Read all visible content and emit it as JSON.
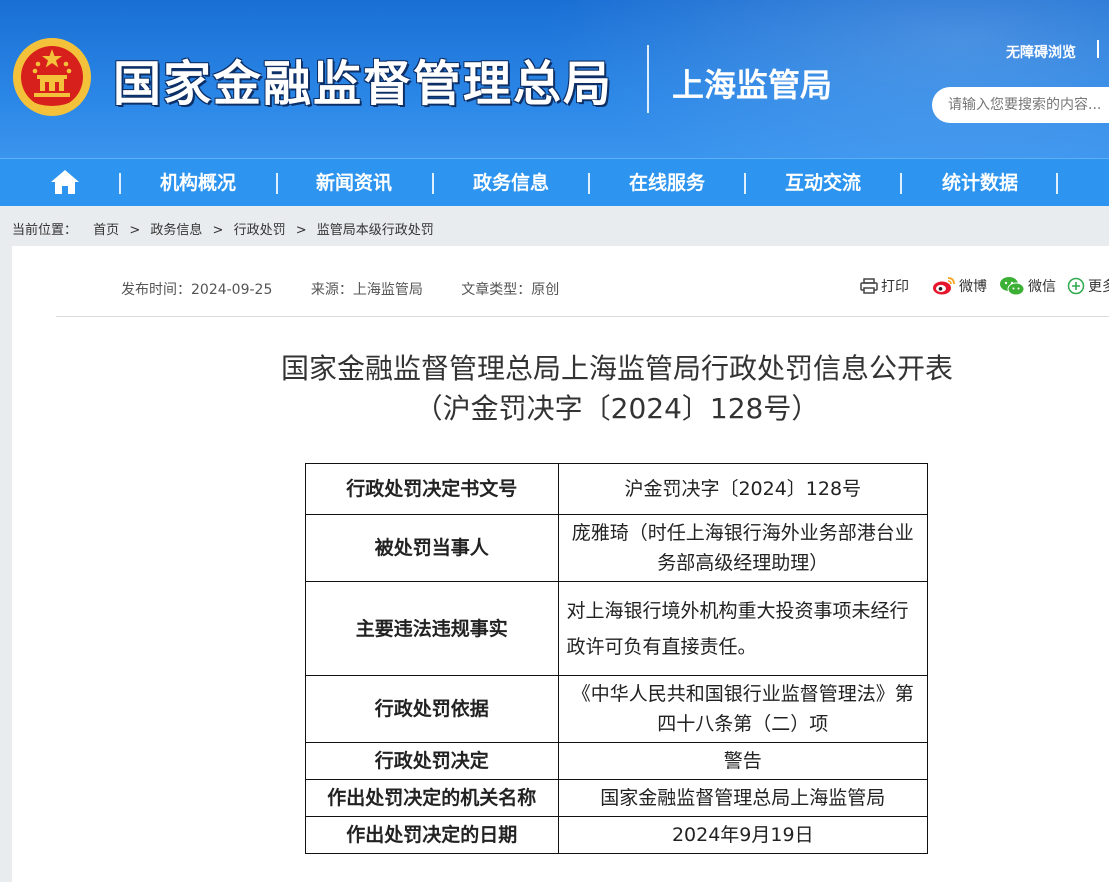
{
  "header": {
    "site_name": "国家金融监督管理总局",
    "sub_name": "上海监管局",
    "accessibility_link": "无障碍浏览",
    "search_placeholder": "请输入您要搜索的内容..."
  },
  "nav": {
    "items": [
      "机构概况",
      "新闻资讯",
      "政务信息",
      "在线服务",
      "互动交流",
      "统计数据"
    ]
  },
  "breadcrumb": {
    "label": "当前位置：",
    "items": [
      "首页",
      "政务信息",
      "行政处罚",
      "监管局本级行政处罚"
    ],
    "separator": ">"
  },
  "article": {
    "publish_time": "发布时间：2024-09-25",
    "source": "来源：上海监管局",
    "type": "文章类型：原创",
    "share": {
      "print": "打印",
      "weibo": "微博",
      "wechat": "微信",
      "more": "更多"
    },
    "title_line1": "国家金融监督管理总局上海监管局行政处罚信息公开表",
    "title_line2": "（沪金罚决字〔2024〕128号）",
    "table": [
      {
        "key": "行政处罚决定书文号",
        "value": "沪金罚决字〔2024〕128号"
      },
      {
        "key": "被处罚当事人",
        "value": "庞雅琦（时任上海银行海外业务部港台业务部高级经理助理）"
      },
      {
        "key": "主要违法违规事实",
        "value": "对上海银行境外机构重大投资事项未经行政许可负有直接责任。"
      },
      {
        "key": "行政处罚依据",
        "value": "《中华人民共和国银行业监督管理法》第四十八条第（二）项"
      },
      {
        "key": "行政处罚决定",
        "value": "警告"
      },
      {
        "key": "作出处罚决定的机关名称",
        "value": "国家金融监督管理总局上海监管局"
      },
      {
        "key": "作出处罚决定的日期",
        "value": "2024年9月19日"
      }
    ]
  },
  "colors": {
    "header_blue": "#1a6fd4",
    "nav_blue": "#2d95f0",
    "emblem_red": "#d7201b",
    "emblem_gold": "#f4c23a"
  }
}
